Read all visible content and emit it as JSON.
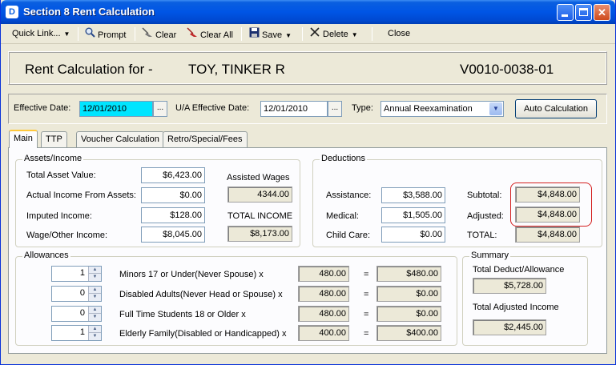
{
  "window": {
    "title": "Section 8 Rent Calculation",
    "app_icon_glyph": "D",
    "min_glyph": "_",
    "max_glyph": "□",
    "close_glyph": "✕"
  },
  "toolbar": {
    "quick_link": "Quick Link...",
    "prompt": "Prompt",
    "clear": "Clear",
    "clear_all": "Clear All",
    "save": "Save",
    "delete": "Delete",
    "close": "Close",
    "dropdown_glyph": "▼",
    "icons": {
      "prompt": "magnifier-icon",
      "clear": "broom-icon",
      "clear_all": "broom-red-icon",
      "save": "floppy-disk-icon",
      "delete": "x-icon"
    }
  },
  "header": {
    "label": "Rent Calculation for -",
    "tenant_name": "TOY, TINKER R",
    "tenant_id": "V0010-0038-01"
  },
  "effective": {
    "effective_date_label": "Effective Date:",
    "effective_date_value": "12/01/2010",
    "ua_label": "U/A Effective Date:",
    "ua_value": "12/01/2010",
    "type_label": "Type:",
    "type_value": "Annual Reexamination",
    "ellipsis": "...",
    "auto_calc": "Auto Calculation"
  },
  "tabs": [
    {
      "label": "Main",
      "active": true
    },
    {
      "label": "TTP"
    },
    {
      "label": "Voucher Calculation"
    },
    {
      "label": "Retro/Special/Fees"
    }
  ],
  "assets": {
    "title": "Assets/Income",
    "total_asset_label": "Total Asset Value:",
    "total_asset_value": "$6,423.00",
    "actual_income_label": "Actual Income From Assets:",
    "actual_income_value": "$0.00",
    "imputed_label": "Imputed Income:",
    "imputed_value": "$128.00",
    "wage_label": "Wage/Other Income:",
    "wage_value": "$8,045.00",
    "assisted_wages_label": "Assisted Wages",
    "assisted_wages_value": "4344.00",
    "total_income_label": "TOTAL INCOME",
    "total_income_value": "$8,173.00"
  },
  "deductions": {
    "title": "Deductions",
    "assistance_label": "Assistance:",
    "assistance_value": "$3,588.00",
    "medical_label": "Medical:",
    "medical_value": "$1,505.00",
    "childcare_label": "Child Care:",
    "childcare_value": "$0.00",
    "subtotal_label": "Subtotal:",
    "subtotal_value": "$4,848.00",
    "adjusted_label": "Adjusted:",
    "adjusted_value": "$4,848.00",
    "total_label": "TOTAL:",
    "total_value": "$4,848.00"
  },
  "allowances": {
    "title": "Allowances",
    "equals": "=",
    "rows": [
      {
        "count": "1",
        "label": "Minors 17 or Under(Never Spouse) x",
        "rate": "480.00",
        "amount": "$480.00"
      },
      {
        "count": "0",
        "label": "Disabled Adults(Never Head or Spouse) x",
        "rate": "480.00",
        "amount": "$0.00"
      },
      {
        "count": "0",
        "label": "Full Time Students 18 or Older x",
        "rate": "480.00",
        "amount": "$0.00"
      },
      {
        "count": "1",
        "label": "Elderly Family(Disabled or Handicapped) x",
        "rate": "400.00",
        "amount": "$400.00"
      }
    ]
  },
  "summary": {
    "title": "Summary",
    "total_deduct_label": "Total Deduct/Allowance",
    "total_deduct_value": "$5,728.00",
    "total_adjusted_label": "Total Adjusted Income",
    "total_adjusted_value": "$2,445.00"
  }
}
